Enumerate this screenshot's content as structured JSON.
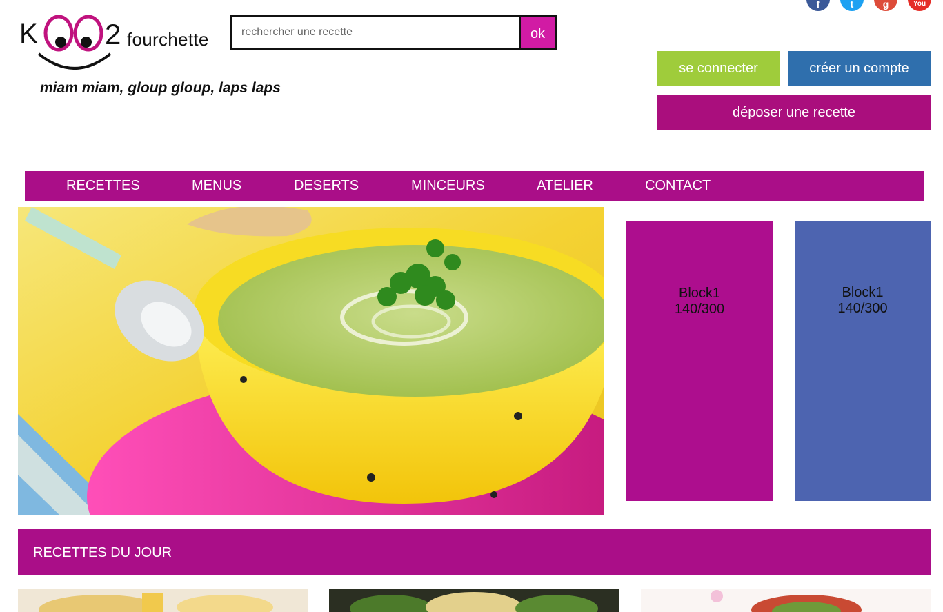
{
  "header": {
    "logo": {
      "text": "KOO2fourchette",
      "suffix": "fourchette"
    },
    "tagline": "miam miam, gloup gloup, laps laps"
  },
  "search": {
    "placeholder": "rechercher une recette",
    "value": "",
    "button_label": "ok"
  },
  "social": [
    {
      "name": "facebook",
      "glyph": "f",
      "color": "#3b5998"
    },
    {
      "name": "twitter",
      "glyph": "t",
      "color": "#1da1f2"
    },
    {
      "name": "google-plus",
      "glyph": "g",
      "color": "#dd4b39"
    },
    {
      "name": "youtube",
      "glyph": "You",
      "color": "#e52d27"
    }
  ],
  "account": {
    "login_label": "se connecter",
    "register_label": "créer un compte",
    "submit_recipe_label": "déposer une recette"
  },
  "nav": {
    "items": [
      "RECETTES",
      "MENUS",
      "DESERTS",
      "MINCEURS",
      "ATELIER",
      "CONTACT"
    ]
  },
  "blocks": [
    {
      "title": "Block1",
      "size": "140/300"
    },
    {
      "title": "Block1",
      "size": "140/300"
    }
  ],
  "section": {
    "title": "RECETTES DU JOUR"
  },
  "colors": {
    "brand_magenta": "#aa0e88",
    "search_button": "#d11ba4",
    "login_green": "#9fcc3b",
    "register_blue": "#2f6fad",
    "block2_blue": "#4d64b0"
  }
}
